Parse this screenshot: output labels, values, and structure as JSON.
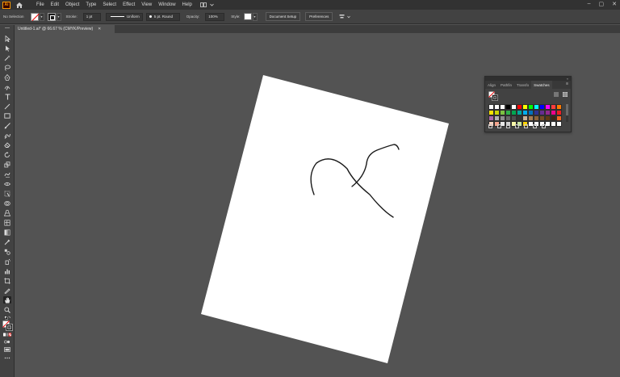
{
  "menubar": {
    "logo_text": "Ai",
    "items": [
      "File",
      "Edit",
      "Object",
      "Type",
      "Select",
      "Effect",
      "View",
      "Window",
      "Help"
    ],
    "window_controls": [
      "–",
      "▢",
      "✕"
    ]
  },
  "controlbar": {
    "selection_label": "No Selection",
    "stroke_label": "Stroke:",
    "stroke_value": "1 pt",
    "profile_value": "Uniform",
    "brush_value": "5 pt. Round",
    "opacity_label": "Opacity:",
    "opacity_value": "100%",
    "style_label": "Style:",
    "document_setup_label": "Document Setup",
    "preferences_label": "Preferences"
  },
  "document": {
    "tab_title": "Untitled-1.ai* @ 66.67 % (CMYK/Preview)",
    "tab_close": "✕"
  },
  "swatches_panel": {
    "collapse_glyph": "«",
    "tabs": [
      "Align",
      "Pathfin",
      "Transfo",
      "Swatches"
    ],
    "active_tab": "Swatches",
    "menu_glyph": "≡",
    "rows": [
      [
        "#ffffff",
        "#ffffff",
        "#ffffff",
        "#000000",
        "#ffffff",
        "#ff0000",
        "#ffff00",
        "#00ff00",
        "#00ffff",
        "#0000ff",
        "#ff00ff",
        "#ff3c3c",
        "#ff7a00"
      ],
      [
        "#f7e000",
        "#c8d400",
        "#7cc242",
        "#2fb04a",
        "#00a651",
        "#00a99d",
        "#00aeef",
        "#0072bc",
        "#2e3192",
        "#662d91",
        "#92278f",
        "#ec008c",
        "#ed1c24"
      ],
      [
        "#a864a8",
        "#b0b0b0",
        "#8c8c8c",
        "#666666",
        "#4d4d4d",
        "#333333",
        "#c7b299",
        "#a67c52",
        "#8c6239",
        "#754c24",
        "#603913",
        "#3c2415",
        "#f26522"
      ],
      [
        "#fbd3c0",
        "#f6a48c",
        "#e8e8e8",
        "#d0d0d0",
        "#f7f7a8",
        "#c9e6a1",
        "#ffd200",
        "#fff",
        "#fff",
        "#fff",
        "#fff",
        "#fff",
        "#fff"
      ]
    ],
    "footer_icons": [
      "swatch-libraries-icon",
      "show-kinds-icon",
      "swatch-options-icon",
      "color-group-icon",
      "new-color-group-icon",
      "new-swatch-icon",
      "delete-swatch-icon"
    ]
  },
  "colors": {
    "accent_orange": "#ff9a00",
    "artboard": "#ffffff",
    "canvas_bg": "#535353",
    "path_stroke": "#1a1a1a"
  }
}
